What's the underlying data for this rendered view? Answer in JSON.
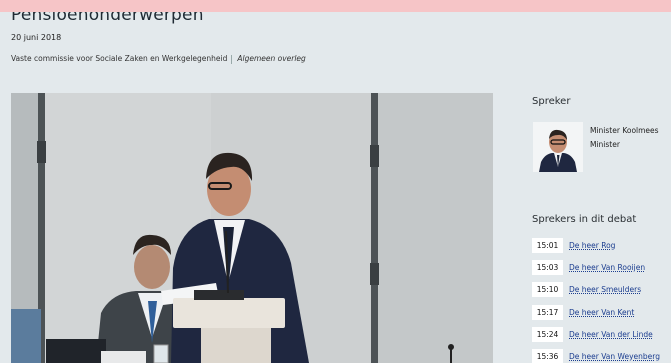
{
  "header": {
    "title": "Pensioenonderwerpen",
    "date": "20 juni 2018",
    "committee": "Vaste commissie voor Sociale Zaken en Werkgelegenheid",
    "meeting_type": "Algemeen overleg"
  },
  "speaker_panel": {
    "heading": "Spreker",
    "name": "Minister Koolmees",
    "role": "Minister"
  },
  "debate_panel": {
    "heading": "Sprekers in dit debat",
    "speakers": [
      {
        "time": "15:01",
        "name": "De heer Rog"
      },
      {
        "time": "15:03",
        "name": "De heer Van Rooijen"
      },
      {
        "time": "15:10",
        "name": "De heer Smeulders"
      },
      {
        "time": "15:17",
        "name": "De heer Van Kent"
      },
      {
        "time": "15:24",
        "name": "De heer Van der Linde"
      },
      {
        "time": "15:36",
        "name": "De heer Van Weyenberg"
      }
    ]
  },
  "colors": {
    "page_bg": "#e3e9ec",
    "link": "#1b3d8f",
    "top_band": "#f6c5c7"
  }
}
